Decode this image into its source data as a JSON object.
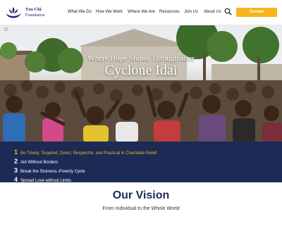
{
  "header": {
    "brand_line1": "Tzu Chi",
    "brand_line2": "Foundation",
    "logo_icon": "lotus-boat-logo",
    "nav": [
      {
        "label": "What We Do"
      },
      {
        "label": "How We Work"
      },
      {
        "label": "Where We Are"
      },
      {
        "label": "Resources"
      },
      {
        "label": "Join Us"
      },
      {
        "label": "About Us"
      }
    ],
    "search_icon": "search-icon",
    "donate_label": "Donate"
  },
  "hero": {
    "line1": "Where Hope Shines Through after",
    "line2": "Cyclone Idai"
  },
  "principles": [
    {
      "num": "1",
      "text": "Be Timely, Targeted, Direct, Respectful, and Practical in Charitable Relief",
      "highlighted": true
    },
    {
      "num": "2",
      "text": "Aid Without Borders",
      "highlighted": false
    },
    {
      "num": "3",
      "text": "Break the Sickness–Poverty Cycle",
      "highlighted": false
    },
    {
      "num": "4",
      "text": "Spread Love without Limits",
      "highlighted": false
    }
  ],
  "vision": {
    "title": "Our Vision",
    "subtitle": "From Individual to the Whole World"
  },
  "colors": {
    "navy": "#1c2a56",
    "accent": "#f5b51b",
    "brand": "#1d2a6b"
  }
}
